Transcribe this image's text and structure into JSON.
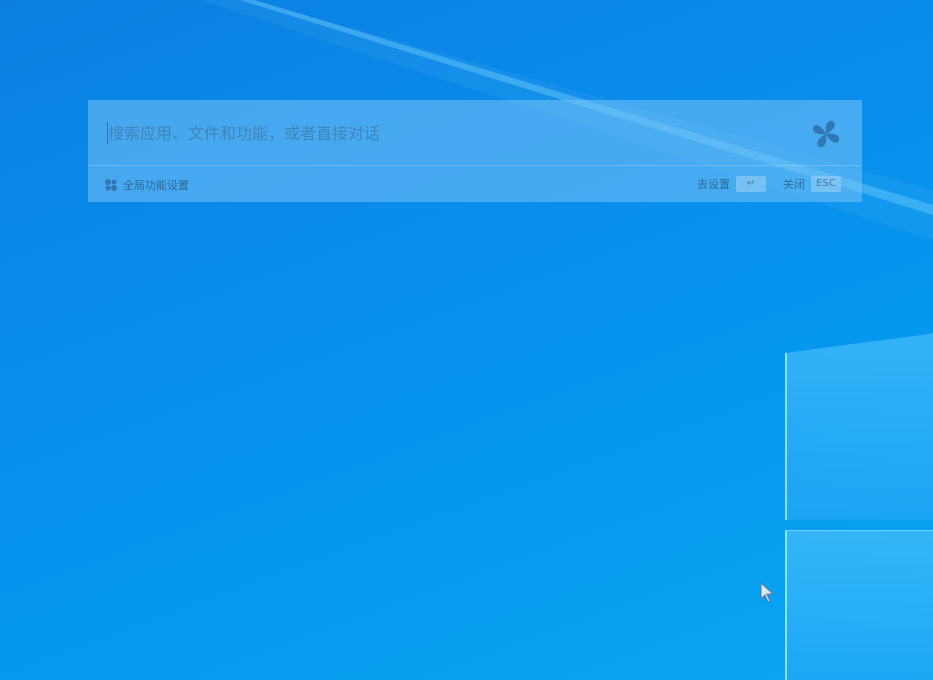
{
  "search": {
    "placeholder": "搜索应用、文件和功能，或者直接对话"
  },
  "footer": {
    "feature_settings_label": "全局功能设置",
    "go_settings_label": "去设置",
    "go_settings_key": "↵",
    "close_label": "关闭",
    "close_key": "ESC"
  },
  "colors": {
    "wallpaper": "#0a8cec",
    "panel": "#78c3f5",
    "accent": "#2f6fa8"
  },
  "icons": {
    "logo": "fan-logo-icon",
    "feature": "fan-small-icon",
    "cursor": "mouse-pointer-icon"
  }
}
